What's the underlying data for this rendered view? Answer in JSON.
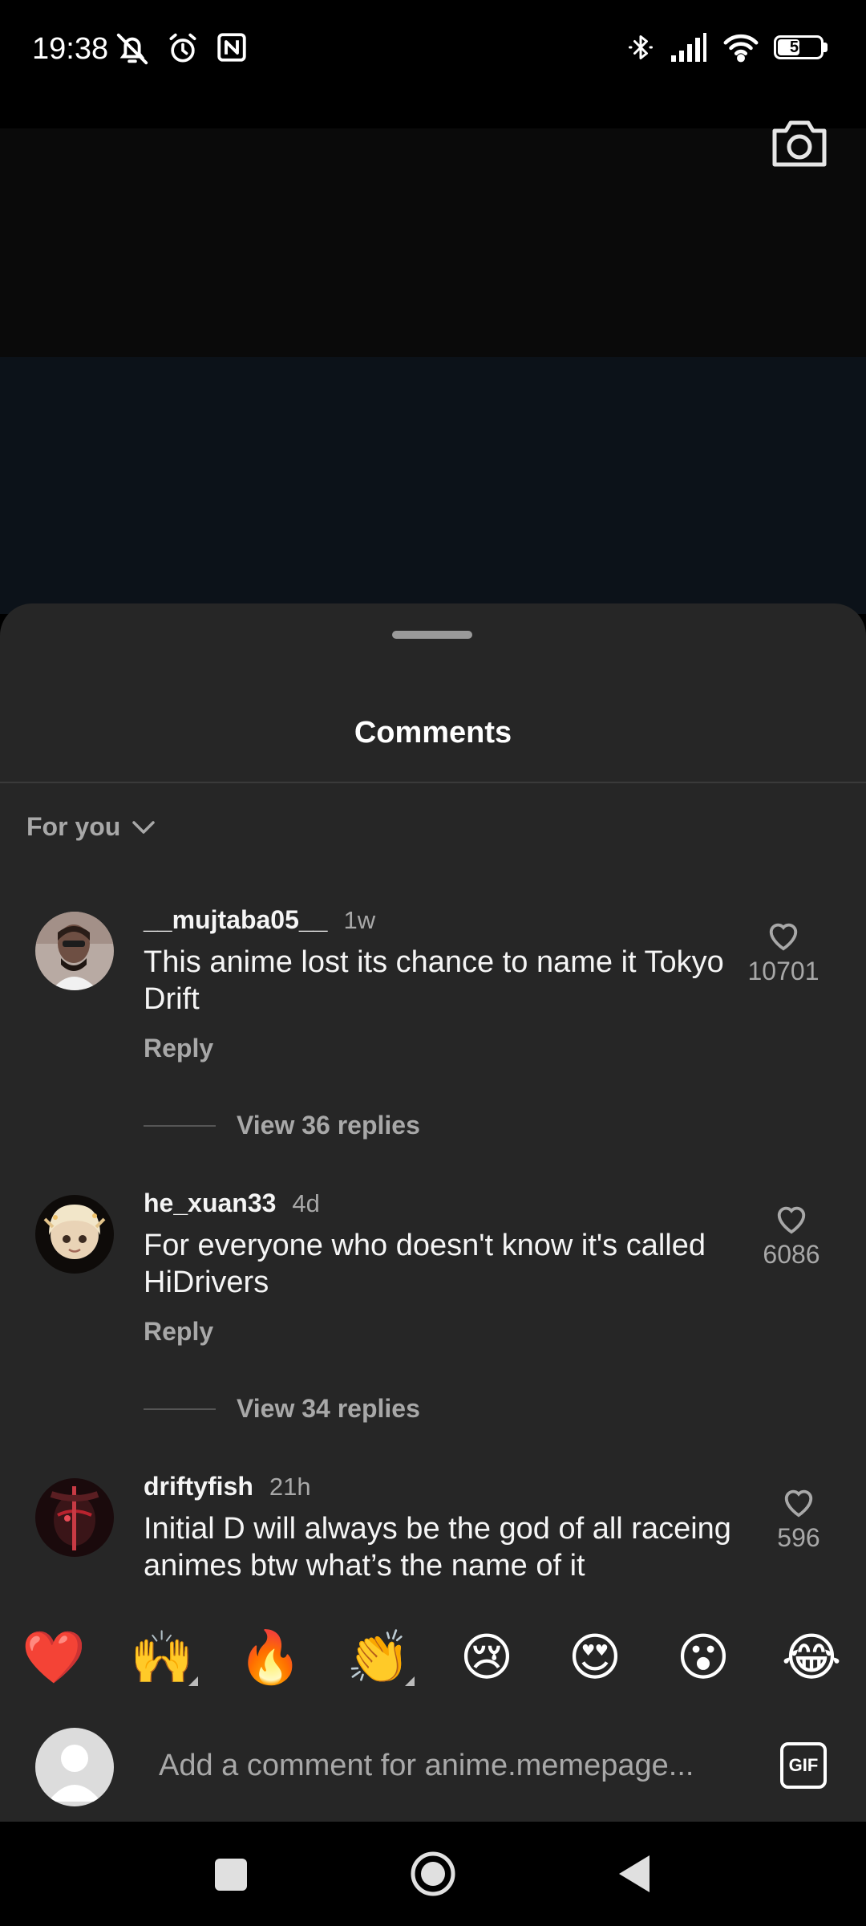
{
  "status_bar": {
    "time": "19:38",
    "battery": "56",
    "battery_level": 0.56,
    "left_icons": [
      "alarm-off-icon",
      "alarm-clock-icon",
      "nfc-icon"
    ],
    "right_icons": [
      "bluetooth-icon",
      "signal-icon",
      "wifi-icon",
      "battery-icon"
    ]
  },
  "video": {
    "camera_icon": "camera-icon"
  },
  "sheet": {
    "title": "Comments",
    "filter_label": "For you"
  },
  "comments": [
    {
      "username": "__mujtaba05__",
      "time": "1w",
      "text": "This anime lost its chance to name it Tokyo Drift",
      "reply_label": "Reply",
      "likes": "10701",
      "view_replies": "View 36 replies"
    },
    {
      "username": "he_xuan33",
      "time": "4d",
      "text": "For everyone who doesn't know it's called HiDrivers",
      "reply_label": "Reply",
      "likes": "6086",
      "view_replies": "View 34 replies"
    },
    {
      "username": "driftyfish",
      "time": "21h",
      "text": "Initial D will always be the god of all raceing animes btw what’s the name of it",
      "likes": "596"
    }
  ],
  "emojis": [
    "❤️",
    "🙌",
    "🔥",
    "👏",
    "😢",
    "😍",
    "😮",
    "😂"
  ],
  "composer": {
    "placeholder": "Add a comment for anime.memepage...",
    "gif_label": "GIF"
  },
  "colors": {
    "sheet_bg": "#262626",
    "secondary_text": "#a8a8a8",
    "primary_text": "#f5f5f5"
  }
}
